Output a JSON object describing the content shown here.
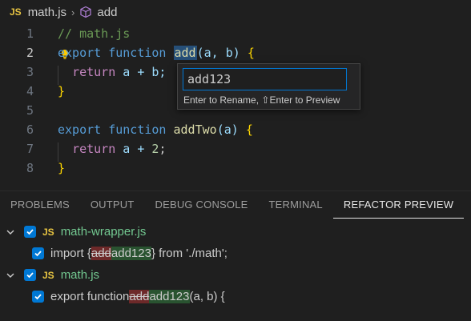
{
  "breadcrumb": {
    "file_badge": "JS",
    "file": "math.js",
    "symbol": "add"
  },
  "editor": {
    "line_numbers": [
      "1",
      "2",
      "3",
      "4",
      "5",
      "6",
      "7",
      "8"
    ],
    "line1": {
      "comment": "// math.js"
    },
    "line2": {
      "kw": "export",
      "kw2": "function",
      "name": "add",
      "params": "(a, b)",
      "brace": "{"
    },
    "line3": {
      "kw": "return",
      "expr": "a + b;"
    },
    "line4": {
      "brace": "}"
    },
    "line6": {
      "kw": "export",
      "kw2": "function",
      "name": "addTwo",
      "params": "(a)",
      "brace": "{"
    },
    "line7": {
      "kw": "return",
      "expr_a": "a + ",
      "num": "2",
      "semi": ";"
    },
    "line8": {
      "brace": "}"
    }
  },
  "rename": {
    "value": "add123",
    "hint": "Enter to Rename, ⇧Enter to Preview"
  },
  "panel": {
    "tabs": [
      "PROBLEMS",
      "OUTPUT",
      "DEBUG CONSOLE",
      "TERMINAL",
      "REFACTOR PREVIEW"
    ],
    "active_tab": "REFACTOR PREVIEW"
  },
  "refactor": {
    "files": [
      {
        "badge": "JS",
        "name": "math-wrapper.js",
        "change": {
          "before": "import { ",
          "old": "add",
          "new": "add123",
          "after": " } from './math';"
        }
      },
      {
        "badge": "JS",
        "name": "math.js",
        "change": {
          "before": "export function ",
          "old": "add",
          "new": "add123",
          "after": "(a, b) {"
        }
      }
    ]
  },
  "colors": {
    "accent": "#0078d4",
    "js_badge": "#e8c542",
    "file_name": "#73c991"
  }
}
